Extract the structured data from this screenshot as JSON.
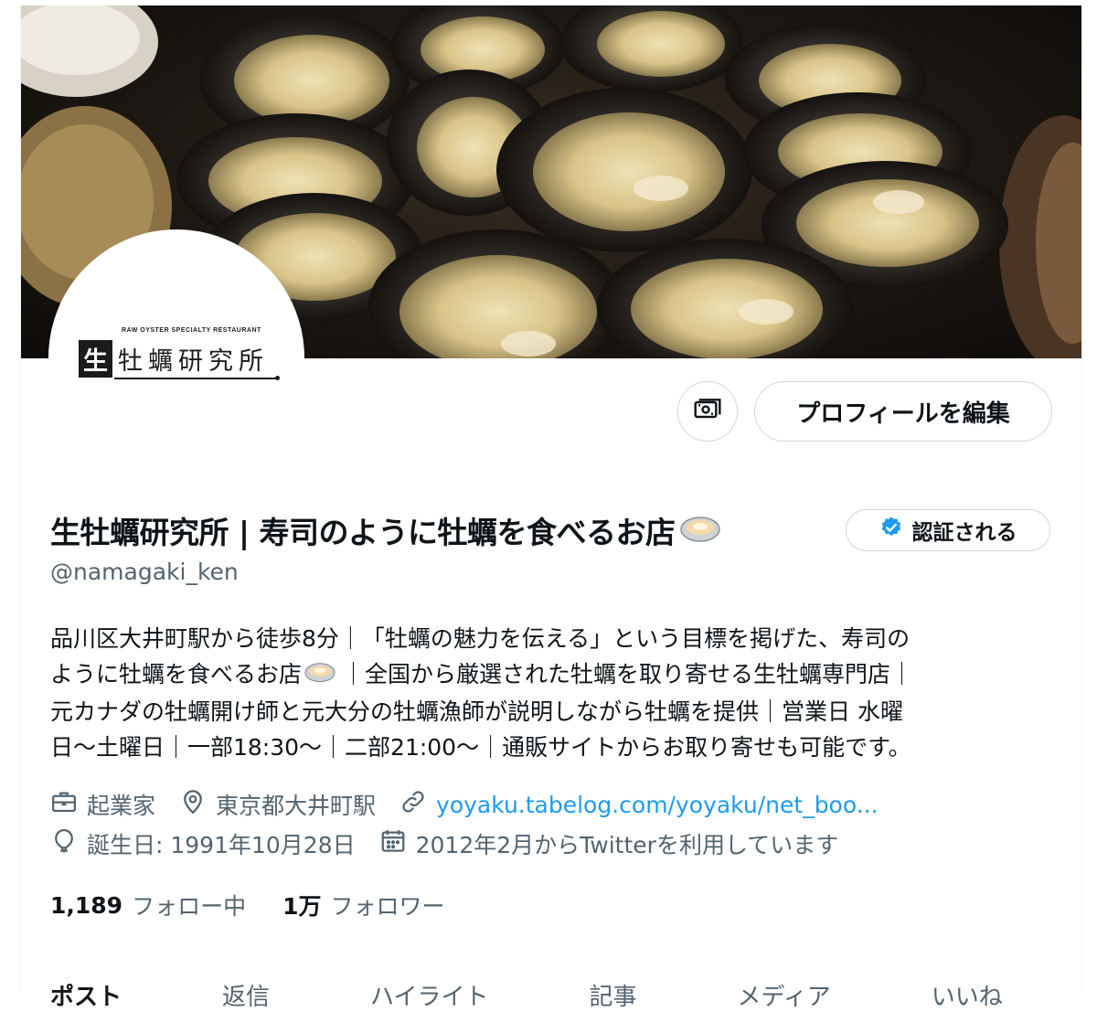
{
  "profile": {
    "display_name": "生牡蠣研究所 | 寿司のように牡蠣を食べるお店",
    "handle": "@namagaki_ken",
    "edit_profile_label": "プロフィールを編集",
    "verify_label": "認証される",
    "avatar": {
      "subtitle": "RAW OYSTER SPECIALTY RESTAURANT",
      "mark": "生",
      "name": "牡蠣研究所"
    },
    "bio": [
      "品川区大井町駅から徒歩8分｜「牡蠣の魅力を伝える」という目標を掲げた、寿司の",
      "ように牡蠣を食べるお店",
      "｜全国から厳選された牡蠣を取り寄せる生牡蠣専門店｜",
      "元カナダの牡蠣開け師と元大分の牡蠣漁師が説明しながら牡蠣を提供｜営業日 水曜",
      "日〜土曜日｜一部18:30〜｜二部21:00〜｜通販サイトからお取り寄せも可能です。"
    ],
    "occupation": "起業家",
    "location": "東京都大井町駅",
    "website": "yoyaku.tabelog.com/yoyaku/net_boo...",
    "birthday": "誕生日: 1991年10月28日",
    "joined": "2012年2月からTwitterを利用しています",
    "following_count": "1,189",
    "following_label": "フォロー中",
    "followers_count": "1万",
    "followers_label": "フォロワー"
  },
  "tabs": [
    "ポスト",
    "返信",
    "ハイライト",
    "記事",
    "メディア",
    "いいね"
  ],
  "colors": {
    "accent": "#1d9bf0",
    "secondary_text": "#536471",
    "border": "#cfd9de"
  },
  "icons": [
    "money-icon",
    "verified-badge-icon",
    "briefcase-icon",
    "location-pin-icon",
    "link-icon",
    "balloon-icon",
    "calendar-icon",
    "oyster-emoji-icon"
  ]
}
